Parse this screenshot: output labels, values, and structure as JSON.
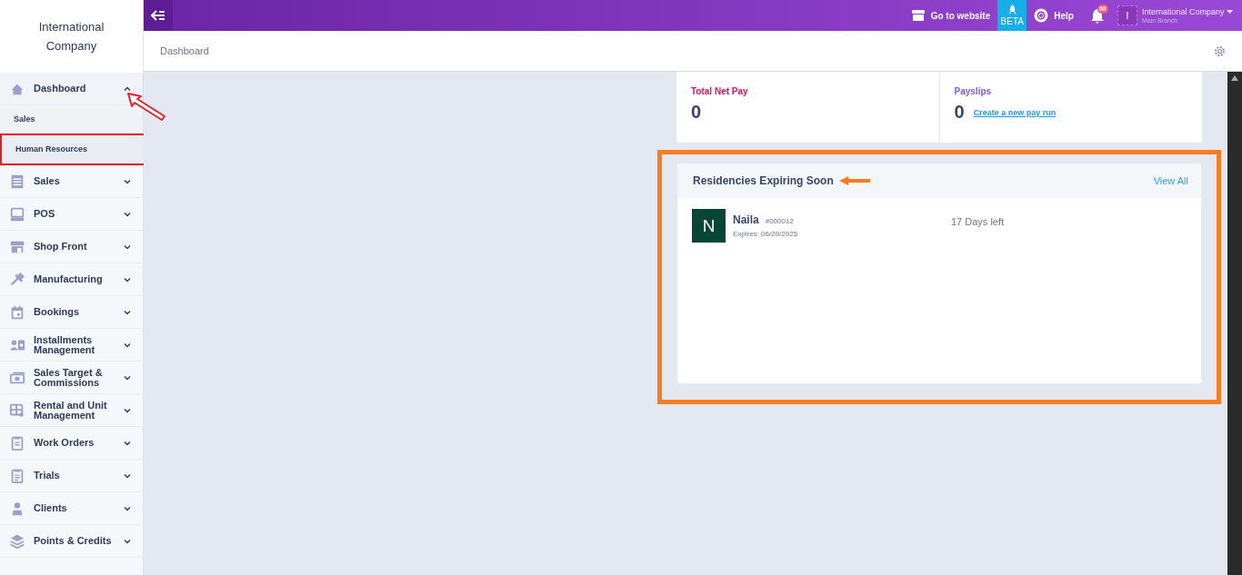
{
  "sidebar": {
    "company": "International Company",
    "items": [
      {
        "label": "Dashboard",
        "expanded": true,
        "children": [
          {
            "label": "Sales",
            "selected": false
          },
          {
            "label": "Human Resources",
            "selected": true,
            "highlighted": true
          }
        ]
      },
      {
        "label": "Sales",
        "expanded": false
      },
      {
        "label": "POS",
        "expanded": false
      },
      {
        "label": "Shop Front",
        "expanded": false
      },
      {
        "label": "Manufacturing",
        "expanded": false
      },
      {
        "label": "Bookings",
        "expanded": false
      },
      {
        "label": "Installments Management",
        "expanded": false
      },
      {
        "label": "Sales Target & Commissions",
        "expanded": false
      },
      {
        "label": "Rental and Unit Management",
        "expanded": false
      },
      {
        "label": "Work Orders",
        "expanded": false
      },
      {
        "label": "Trials",
        "expanded": false
      },
      {
        "label": "Clients",
        "expanded": false
      },
      {
        "label": "Points & Credits",
        "expanded": false
      }
    ]
  },
  "topbar": {
    "website": "Go to website",
    "beta": "BETA",
    "help": "Help",
    "notifications": "68",
    "avatar": "I",
    "account": "International Company",
    "branch": "Main Branch"
  },
  "breadcrumb": "Dashboard",
  "stats": [
    {
      "label": "Total Net Pay",
      "value": "0",
      "color": "#e0125f"
    },
    {
      "label": "Payslips",
      "value": "0",
      "color": "#7b5cf0",
      "link": "Create a new pay run"
    }
  ],
  "residencies": {
    "title": "Residencies Expiring Soon",
    "view_all": "View All",
    "highlighted": true,
    "rows": [
      {
        "initial": "N",
        "name": "Naila",
        "code": "#000012",
        "expires": "Expires: 06/20/2025",
        "remaining": "17 Days left"
      }
    ]
  }
}
